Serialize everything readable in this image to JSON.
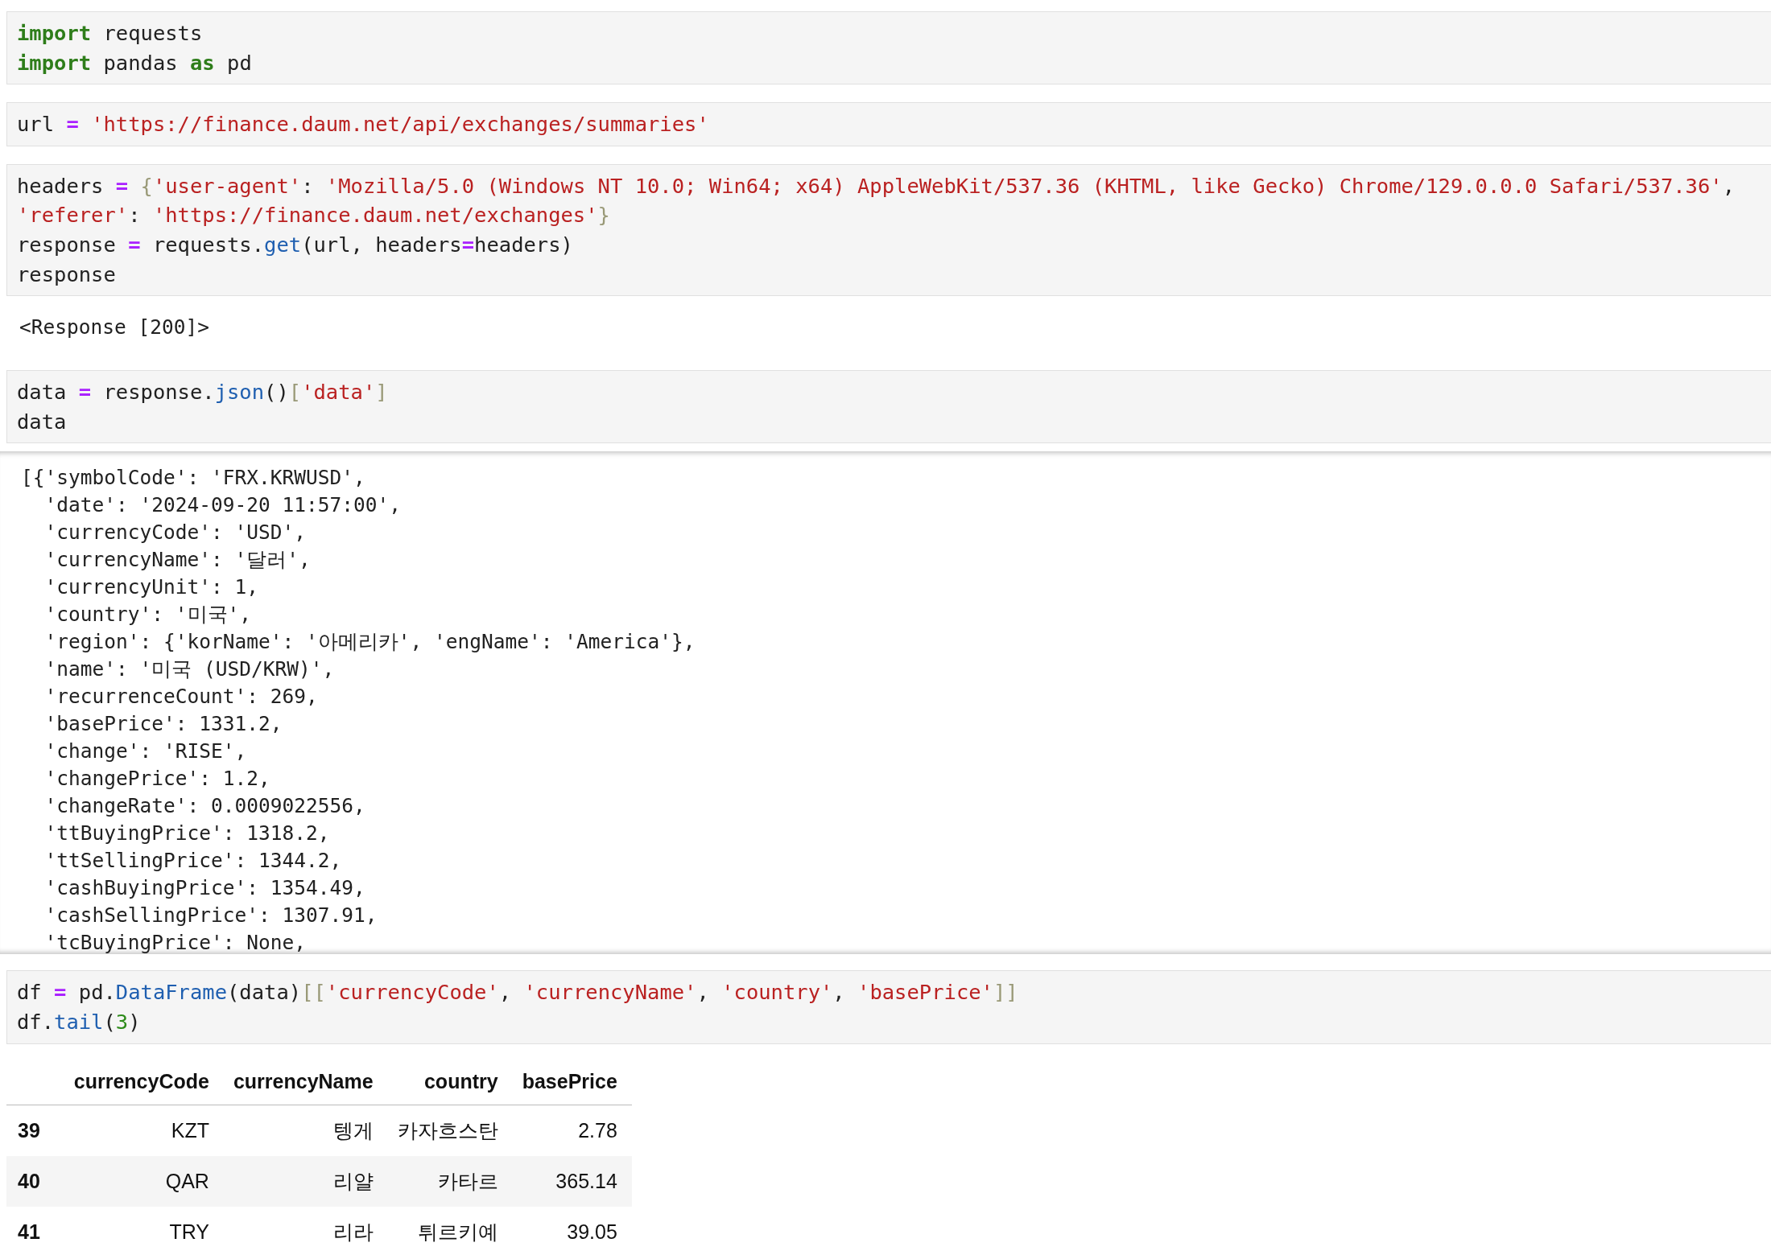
{
  "cells": [
    {
      "kind": "code",
      "lines": [
        [
          {
            "kind": "keyword",
            "text": "import"
          },
          {
            "kind": "name",
            "text": " requests"
          }
        ],
        [
          {
            "kind": "keyword",
            "text": "import"
          },
          {
            "kind": "name",
            "text": " pandas "
          },
          {
            "kind": "keyword",
            "text": "as"
          },
          {
            "kind": "name",
            "text": " pd"
          }
        ]
      ]
    },
    {
      "kind": "code",
      "lines": [
        [
          {
            "kind": "name",
            "text": "url "
          },
          {
            "kind": "op",
            "text": "= "
          },
          {
            "kind": "string",
            "text": "'https://finance.daum.net/api/exchanges/summaries'"
          }
        ]
      ]
    },
    {
      "kind": "code",
      "lines": [
        [
          {
            "kind": "name",
            "text": "headers "
          },
          {
            "kind": "op",
            "text": "= "
          },
          {
            "kind": "bracket",
            "text": "{"
          },
          {
            "kind": "string",
            "text": "'user-agent'"
          },
          {
            "kind": "name",
            "text": ": "
          },
          {
            "kind": "string",
            "text": "'Mozilla/5.0 (Windows NT 10.0; Win64; x64) AppleWebKit/537.36 (KHTML, like Gecko) Chrome/129.0.0.0 Safari/537.36'"
          },
          {
            "kind": "name",
            "text": ","
          }
        ],
        [
          {
            "kind": "string",
            "text": "'referer'"
          },
          {
            "kind": "name",
            "text": ": "
          },
          {
            "kind": "string",
            "text": "'https://finance.daum.net/exchanges'"
          },
          {
            "kind": "bracket",
            "text": "}"
          }
        ],
        [
          {
            "kind": "name",
            "text": "response "
          },
          {
            "kind": "op",
            "text": "="
          },
          {
            "kind": "name",
            "text": " requests."
          },
          {
            "kind": "func",
            "text": "get"
          },
          {
            "kind": "name",
            "text": "(url, headers"
          },
          {
            "kind": "op",
            "text": "="
          },
          {
            "kind": "name",
            "text": "headers)"
          }
        ],
        [
          {
            "kind": "name",
            "text": "response"
          }
        ]
      ]
    },
    {
      "kind": "output",
      "lines": [
        "<Response [200]>"
      ]
    },
    {
      "kind": "code",
      "lines": [
        [
          {
            "kind": "name",
            "text": "data "
          },
          {
            "kind": "op",
            "text": "="
          },
          {
            "kind": "name",
            "text": " response."
          },
          {
            "kind": "func",
            "text": "json"
          },
          {
            "kind": "name",
            "text": "()"
          },
          {
            "kind": "bracket",
            "text": "["
          },
          {
            "kind": "string",
            "text": "'data'"
          },
          {
            "kind": "bracket",
            "text": "]"
          }
        ],
        [
          {
            "kind": "name",
            "text": "data"
          }
        ]
      ]
    },
    {
      "kind": "scrolled_output",
      "lines": [
        "[{'symbolCode': 'FRX.KRWUSD',",
        "  'date': '2024-09-20 11:57:00',",
        "  'currencyCode': 'USD',",
        "  'currencyName': '달러',",
        "  'currencyUnit': 1,",
        "  'country': '미국',",
        "  'region': {'korName': '아메리카', 'engName': 'America'},",
        "  'name': '미국 (USD/KRW)',",
        "  'recurrenceCount': 269,",
        "  'basePrice': 1331.2,",
        "  'change': 'RISE',",
        "  'changePrice': 1.2,",
        "  'changeRate': 0.0009022556,",
        "  'ttBuyingPrice': 1318.2,",
        "  'ttSellingPrice': 1344.2,",
        "  'cashBuyingPrice': 1354.49,",
        "  'cashSellingPrice': 1307.91,",
        "  'tcBuyingPrice': None,"
      ]
    },
    {
      "kind": "code",
      "lines": [
        [
          {
            "kind": "name",
            "text": "df "
          },
          {
            "kind": "op",
            "text": "="
          },
          {
            "kind": "name",
            "text": " pd."
          },
          {
            "kind": "func",
            "text": "DataFrame"
          },
          {
            "kind": "name",
            "text": "(data)"
          },
          {
            "kind": "bracket",
            "text": "[["
          },
          {
            "kind": "string",
            "text": "'currencyCode'"
          },
          {
            "kind": "name",
            "text": ", "
          },
          {
            "kind": "string",
            "text": "'currencyName'"
          },
          {
            "kind": "name",
            "text": ", "
          },
          {
            "kind": "string",
            "text": "'country'"
          },
          {
            "kind": "name",
            "text": ", "
          },
          {
            "kind": "string",
            "text": "'basePrice'"
          },
          {
            "kind": "bracket",
            "text": "]]"
          }
        ],
        [
          {
            "kind": "name",
            "text": "df."
          },
          {
            "kind": "func",
            "text": "tail"
          },
          {
            "kind": "name",
            "text": "("
          },
          {
            "kind": "number",
            "text": "3"
          },
          {
            "kind": "name",
            "text": ")"
          }
        ]
      ]
    },
    {
      "kind": "table",
      "columns": [
        "currencyCode",
        "currencyName",
        "country",
        "basePrice"
      ],
      "rows": [
        {
          "index": "39",
          "cells": [
            "KZT",
            "텡게",
            "카자흐스탄",
            "2.78"
          ]
        },
        {
          "index": "40",
          "cells": [
            "QAR",
            "리얄",
            "카타르",
            "365.14"
          ]
        },
        {
          "index": "41",
          "cells": [
            "TRY",
            "리라",
            "튀르키예",
            "39.05"
          ]
        }
      ]
    }
  ]
}
